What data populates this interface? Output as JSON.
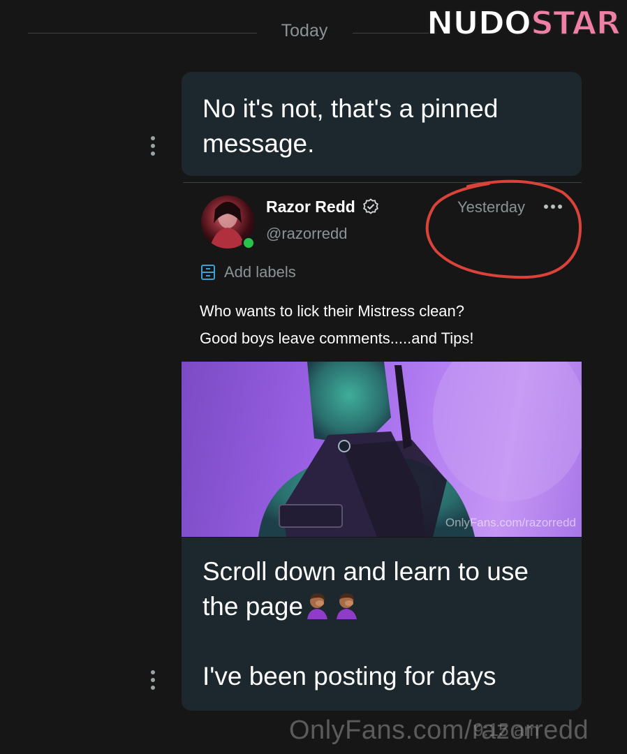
{
  "date_divider": "Today",
  "watermark_logo": {
    "part1": "NUDO",
    "part2": "STAR"
  },
  "pinned_reply": {
    "text": "No it's not, that's a pinned message."
  },
  "post": {
    "author_name": "Razor Redd",
    "handle": "@razorredd",
    "time": "Yesterday",
    "add_labels": "Add labels",
    "caption_line1": "Who wants to lick their Mistress clean?",
    "caption_line2": "Good boys leave comments.....and Tips!",
    "image_watermark": "OnlyFans.com/razorredd"
  },
  "message": {
    "line1": "Scroll down and learn to use",
    "line2": "the page",
    "line3": "I've been posting for days",
    "time": "9:15 am"
  },
  "bottom_watermark": "OnlyFans.com/razorredd",
  "colors": {
    "bubble": "#1c282d",
    "background": "#161616",
    "accent": "#f07fa6",
    "annotation": "#d9433a",
    "online": "#29c24a"
  },
  "icons": [
    "kebab-icon",
    "verified-icon",
    "more-horizontal-icon",
    "label-icon",
    "facepalm-emoji"
  ]
}
